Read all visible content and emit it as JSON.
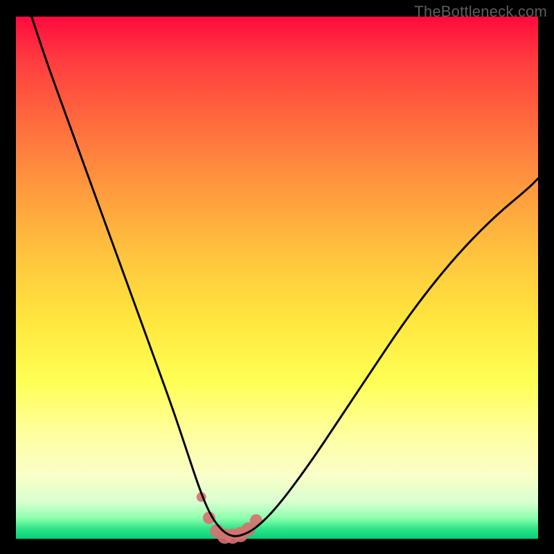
{
  "watermark": "TheBottleneck.com",
  "colors": {
    "frame_bg_top": "#ff0a3e",
    "frame_bg_bottom": "#00d27a",
    "curve": "#000000",
    "marker": "#d87070",
    "page_bg": "#000000",
    "watermark": "#5e5e5e"
  },
  "chart_data": {
    "type": "line",
    "title": "",
    "xlabel": "",
    "ylabel": "",
    "xlim": [
      0,
      100
    ],
    "ylim": [
      0,
      100
    ],
    "grid": false,
    "legend": false,
    "series": [
      {
        "name": "bottleneck-curve",
        "x": [
          3,
          6,
          10,
          14,
          18,
          22,
          26,
          30,
          33,
          35,
          37,
          39,
          41,
          43,
          46,
          50,
          56,
          62,
          68,
          74,
          80,
          86,
          92,
          98,
          100
        ],
        "y": [
          100,
          91,
          80,
          69,
          58,
          47,
          36,
          25,
          16,
          10,
          5,
          2,
          0.5,
          0.5,
          2,
          6,
          14,
          23,
          32,
          41,
          49,
          56,
          62,
          67,
          69
        ]
      }
    ],
    "markers": {
      "name": "highlight-points",
      "x": [
        35.5,
        37,
        38.5,
        40,
        41.5,
        43,
        44.5,
        46
      ],
      "y": [
        8,
        4,
        1.5,
        0.5,
        0.5,
        0.8,
        1.8,
        3.5
      ],
      "r": [
        7,
        9,
        10,
        11,
        11,
        11,
        10,
        9
      ]
    }
  }
}
